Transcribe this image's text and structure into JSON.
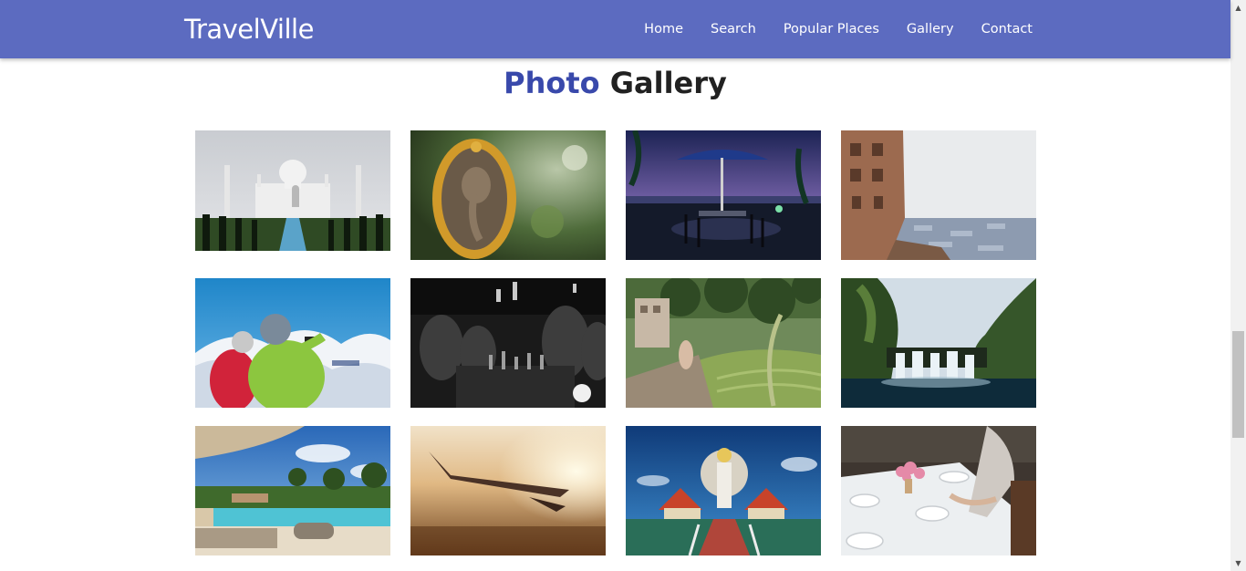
{
  "navbar": {
    "brand": "TravelVille",
    "links": [
      "Home",
      "Search",
      "Popular Places",
      "Gallery",
      "Contact"
    ],
    "background_color": "#5c6bc0"
  },
  "heading": {
    "accent": "Photo",
    "rest": "Gallery",
    "accent_color": "#3949ab"
  },
  "gallery": {
    "photos": [
      {
        "subject": "taj-mahal"
      },
      {
        "subject": "ganesha-statue"
      },
      {
        "subject": "rooftop-terrace-umbrella"
      },
      {
        "subject": "fort-overlooking-blue-city"
      },
      {
        "subject": "hikers-photographing-mountains"
      },
      {
        "subject": "bar-black-and-white"
      },
      {
        "subject": "woman-rice-terraces"
      },
      {
        "subject": "waterfall-cliffs"
      },
      {
        "subject": "resort-pool"
      },
      {
        "subject": "airplane-wing-sunset"
      },
      {
        "subject": "thai-temple-statue"
      },
      {
        "subject": "dining-table-setting"
      }
    ]
  }
}
